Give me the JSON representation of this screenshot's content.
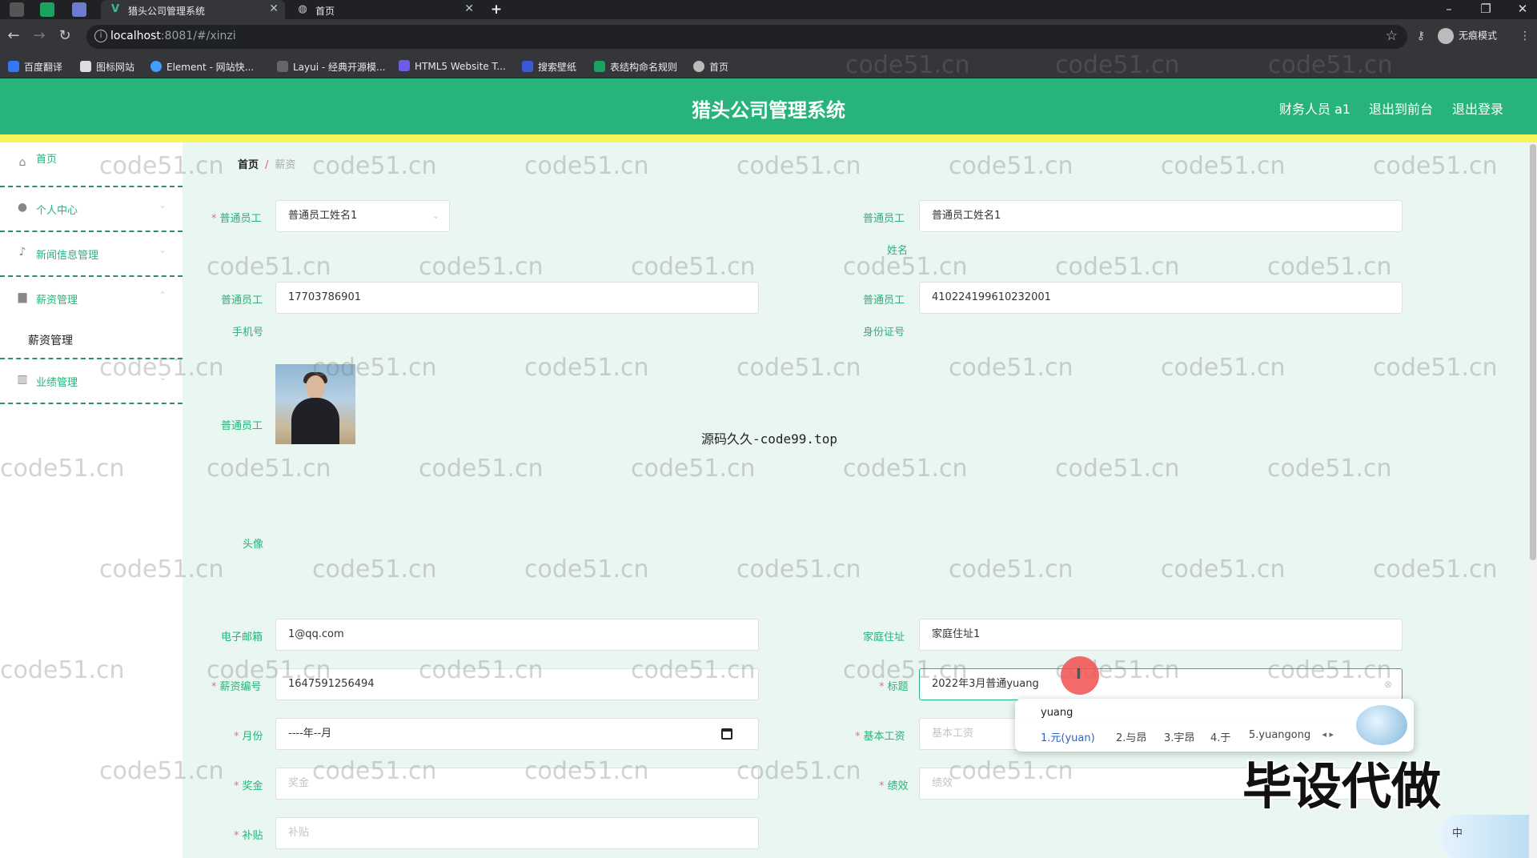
{
  "browser": {
    "tabs": [
      {
        "label": "猎头公司管理系统",
        "icon": "vue-icon"
      },
      {
        "label": "首页",
        "icon": "globe-icon"
      }
    ],
    "new_tab": "+",
    "url_host": "localhost",
    "url_rest": ":8081/#/xinzi",
    "incognito_label": "无痕模式",
    "bookmarks": [
      "百度翻译",
      "图标网站",
      "Element - 网站快...",
      "Layui - 经典开源模...",
      "HTML5 Website T...",
      "搜索壁纸",
      "表结构命名规则",
      "首页"
    ]
  },
  "header": {
    "title": "猎头公司管理系统",
    "user": "财务人员 a1",
    "back_front": "退出到前台",
    "logout": "退出登录"
  },
  "sidebar": {
    "items": [
      {
        "label": "首页",
        "icon": "home-icon"
      },
      {
        "label": "个人中心",
        "icon": "user-icon"
      },
      {
        "label": "新闻信息管理",
        "icon": "mic-icon"
      },
      {
        "label": "薪资管理",
        "icon": "briefcase-icon"
      },
      {
        "label": "业绩管理",
        "icon": "trash-icon"
      }
    ],
    "submenu": "薪资管理"
  },
  "breadcrumb": {
    "home": "首页",
    "sep": "/",
    "current": "薪资"
  },
  "form": {
    "employee_label": "普通员工",
    "employee_select": "普通员工姓名1",
    "name_label_a": "普通员工",
    "name_label_b": "姓名",
    "name_value": "普通员工姓名1",
    "phone_label_a": "普通员工",
    "phone_label_b": "手机号",
    "phone_value": "17703786901",
    "idcard_label_a": "普通员工",
    "idcard_label_b": "身份证号",
    "idcard_value": "410224199610232001",
    "avatar_label_a": "普通员工",
    "avatar_label_b": "头像",
    "email_label": "电子邮箱",
    "email_value": "1@qq.com",
    "address_label": "家庭住址",
    "address_value": "家庭住址1",
    "salary_no_label": "薪资编号",
    "salary_no_value": "1647591256494",
    "title_label": "标题",
    "title_value": "2022年3月普通yuang",
    "month_label": "月份",
    "month_value": "----年--月",
    "base_label": "基本工资",
    "base_placeholder": "基本工资",
    "bonus_label": "奖金",
    "bonus_placeholder": "奖金",
    "perf_label": "绩效",
    "perf_placeholder": "绩效",
    "subsidy_label": "补贴",
    "subsidy_placeholder": "补贴",
    "required_mark": "*"
  },
  "ime": {
    "composition": "yuang",
    "candidates": [
      "1.元(yuan)",
      "2.与昂",
      "3.宇昂",
      "4.于",
      "5.yuangong"
    ],
    "nav": "◂ ▸",
    "tray": "中"
  },
  "overlays": {
    "source_text": "源码久久-code99.top",
    "promo_text": "毕设代做",
    "watermark": "code51.cn"
  },
  "colors": {
    "header": "#27b37a",
    "accent_bar": "#f6f65c",
    "label": "#27b37a",
    "content_bg": "#eaf6f1"
  }
}
